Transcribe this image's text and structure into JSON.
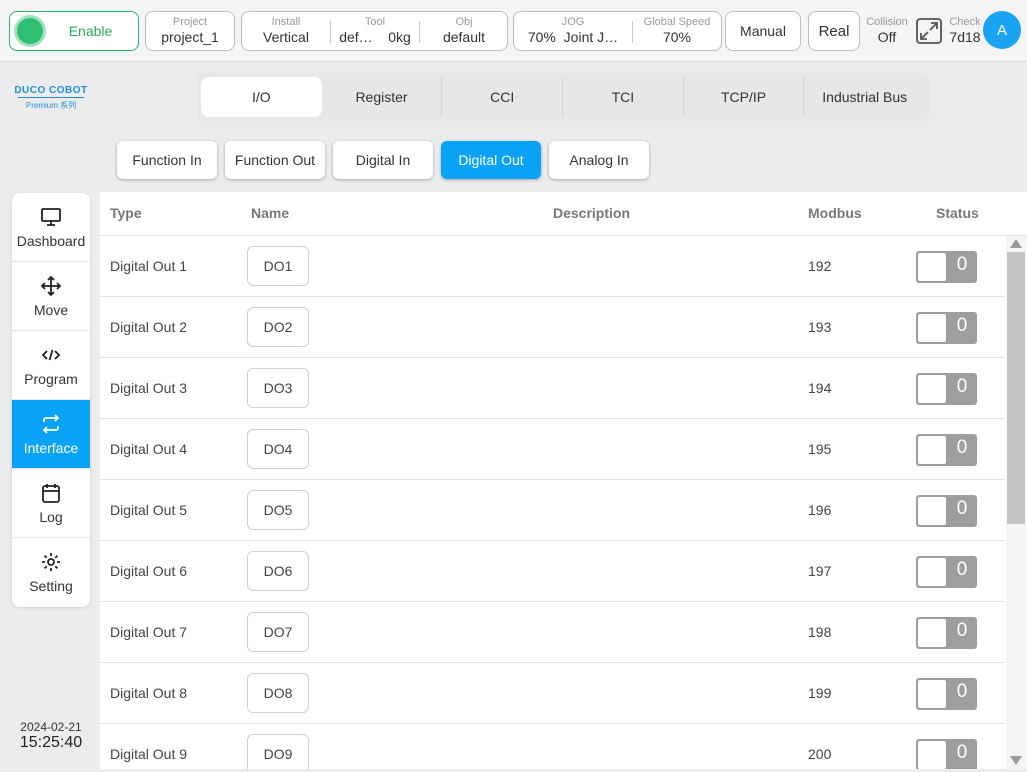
{
  "topbar": {
    "enable_label": "Enable",
    "project": {
      "label": "Project",
      "value": "project_1"
    },
    "install": {
      "label": "Install",
      "value": "Vertical"
    },
    "tool": {
      "label": "Tool",
      "value1": "def…",
      "value2": "0kg"
    },
    "obj": {
      "label": "Obj",
      "value": "default"
    },
    "jog": {
      "label": "JOG",
      "value1": "70%",
      "value2": "Joint J…"
    },
    "global_speed": {
      "label": "Global Speed",
      "value": "70%"
    },
    "mode_button": "Manual",
    "real_button": "Real",
    "collision": {
      "label": "Collision",
      "value": "Off"
    },
    "check": {
      "label": "Check",
      "value": "7d18"
    },
    "avatar": "A"
  },
  "logo": {
    "line1": "DUCO COBOT",
    "line2": "Premium 系列"
  },
  "sidebar": {
    "items": [
      {
        "label": "Dashboard",
        "icon": "monitor-icon"
      },
      {
        "label": "Move",
        "icon": "move-arrows-icon"
      },
      {
        "label": "Program",
        "icon": "code-icon"
      },
      {
        "label": "Interface",
        "icon": "swap-arrows-icon"
      },
      {
        "label": "Log",
        "icon": "calendar-icon"
      },
      {
        "label": "Setting",
        "icon": "gear-icon"
      }
    ],
    "active": "Interface"
  },
  "datetime": {
    "date": "2024-02-21",
    "time": "15:25:40"
  },
  "tabs": [
    "I/O",
    "Register",
    "CCI",
    "TCI",
    "TCP/IP",
    "Industrial Bus"
  ],
  "active_tab": "I/O",
  "subtabs": [
    "Function In",
    "Function Out",
    "Digital In",
    "Digital Out",
    "Analog In"
  ],
  "active_subtab": "Digital Out",
  "table": {
    "headers": {
      "type": "Type",
      "name": "Name",
      "description": "Description",
      "modbus": "Modbus",
      "status": "Status"
    },
    "rows": [
      {
        "type": "Digital Out 1",
        "name": "DO1",
        "modbus": "192",
        "status": "0"
      },
      {
        "type": "Digital Out 2",
        "name": "DO2",
        "modbus": "193",
        "status": "0"
      },
      {
        "type": "Digital Out 3",
        "name": "DO3",
        "modbus": "194",
        "status": "0"
      },
      {
        "type": "Digital Out 4",
        "name": "DO4",
        "modbus": "195",
        "status": "0"
      },
      {
        "type": "Digital Out 5",
        "name": "DO5",
        "modbus": "196",
        "status": "0"
      },
      {
        "type": "Digital Out 6",
        "name": "DO6",
        "modbus": "197",
        "status": "0"
      },
      {
        "type": "Digital Out 7",
        "name": "DO7",
        "modbus": "198",
        "status": "0"
      },
      {
        "type": "Digital Out 8",
        "name": "DO8",
        "modbus": "199",
        "status": "0"
      },
      {
        "type": "Digital Out 9",
        "name": "DO9",
        "modbus": "200",
        "status": "0"
      }
    ]
  },
  "colors": {
    "accent": "#0aa2f5",
    "enable_green": "#2fbf71",
    "toggle_off": "#9e9e9e"
  }
}
